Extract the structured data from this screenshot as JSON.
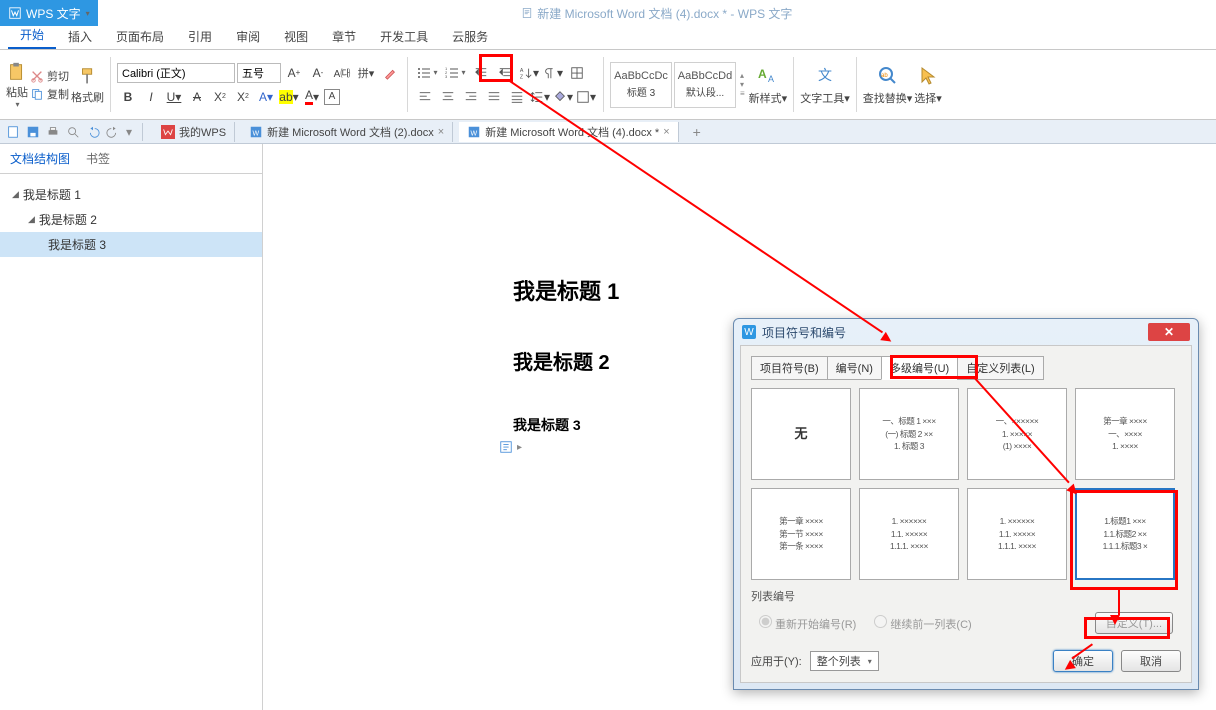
{
  "app": {
    "name": "WPS 文字",
    "title_doc": "新建 Microsoft Word 文档 (4).docx * - WPS 文字"
  },
  "menutabs": [
    "开始",
    "插入",
    "页面布局",
    "引用",
    "审阅",
    "视图",
    "章节",
    "开发工具",
    "云服务"
  ],
  "clipboard": {
    "paste": "粘贴",
    "cut": "剪切",
    "copy": "复制",
    "fmtpainter": "格式刷"
  },
  "font": {
    "name": "Calibri (正文)",
    "size": "五号"
  },
  "styles": [
    {
      "sample": "AaBbCcDc",
      "name": "标题 3"
    },
    {
      "sample": "AaBbCcDd",
      "name": "默认段..."
    }
  ],
  "right_groups": {
    "newstyle": "新样式",
    "texttools": "文字工具",
    "findreplace": "查找替换",
    "select": "选择"
  },
  "doc_tabs": {
    "mywps": "我的WPS",
    "doc2": "新建 Microsoft Word 文档 (2).docx",
    "doc4": "新建 Microsoft Word 文档 (4).docx *"
  },
  "sidebar": {
    "tab_outline": "文档结构图",
    "tab_bookmark": "书签",
    "items": [
      "我是标题 1",
      "我是标题 2",
      "我是标题 3"
    ]
  },
  "page": {
    "h1": "我是标题 1",
    "h2": "我是标题 2",
    "h3": "我是标题 3"
  },
  "dialog": {
    "title": "项目符号和编号",
    "tabs": [
      "项目符号(B)",
      "编号(N)",
      "多级编号(U)",
      "自定义列表(L)"
    ],
    "none": "无",
    "samples": {
      "r1c2": [
        "一、标题 1 ×××",
        "(一) 标题 2 ××",
        "  1. 标题 3"
      ],
      "r1c3": [
        "一、××××××",
        "  1. ×××××",
        "  (1) ××××"
      ],
      "r1c4": [
        "第一章 ××××",
        "  一、××××",
        "   1. ××××"
      ],
      "r2c1": [
        "第一章 ××××",
        "第一节 ××××",
        "第一条 ××××"
      ],
      "r2c2": [
        "1. ××××××",
        "1.1. ×××××",
        "1.1.1. ××××"
      ],
      "r2c3": [
        "1. ××××××",
        "1.1. ×××××",
        "1.1.1. ××××"
      ],
      "r2c4": [
        "1.标题1 ×××",
        "1.1.标题2 ××",
        "1.1.1.标题3 ×"
      ]
    },
    "list_number_label": "列表编号",
    "radio_restart": "重新开始编号(R)",
    "radio_continue": "继续前一列表(C)",
    "custom": "自定义(T)...",
    "apply_to": "应用于(Y):",
    "apply_val": "整个列表",
    "ok": "确定",
    "cancel": "取消"
  }
}
